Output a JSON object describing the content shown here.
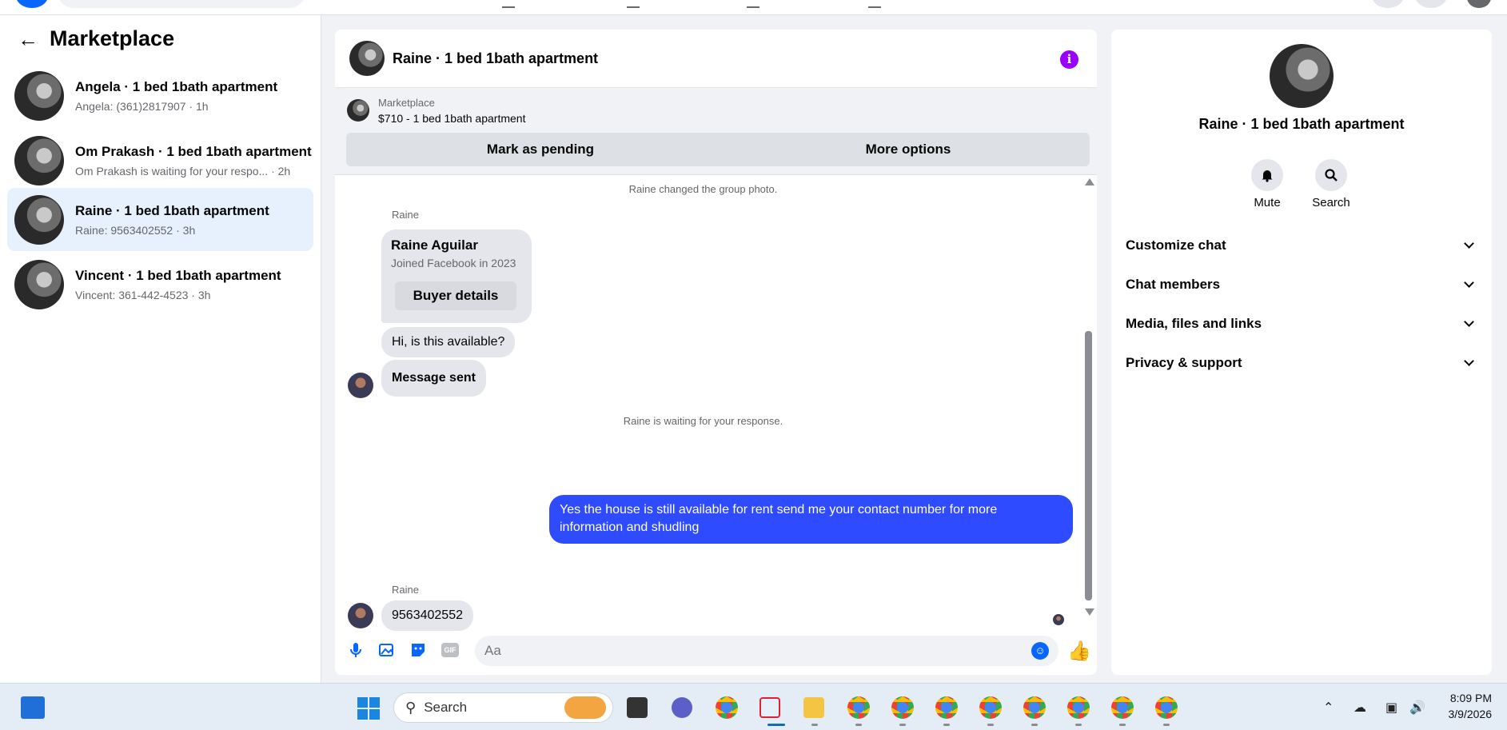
{
  "sidebar": {
    "title": "Marketplace",
    "conversations": [
      {
        "name": "Angela · 1 bed 1bath apartment",
        "preview": "Angela: (361)2817907 · 1h"
      },
      {
        "name": "Om Prakash · 1 bed 1bath apartment",
        "preview": "Om Prakash is waiting for your respo... · 2h"
      },
      {
        "name": "Raine · 1 bed 1bath apartment",
        "preview": "Raine: 9563402552 · 3h"
      },
      {
        "name": "Vincent · 1 bed 1bath apartment",
        "preview": "Vincent: 361-442-4523 · 3h"
      }
    ]
  },
  "chat": {
    "title": "Raine · 1 bed 1bath apartment",
    "listing": {
      "label": "Marketplace",
      "title": "$710 - 1 bed 1bath apartment",
      "mark_pending": "Mark as pending",
      "more_options": "More options"
    },
    "messages": {
      "group_photo": "Raine changed the group photo.",
      "sender1": "Raine",
      "card_name": "Raine Aguilar",
      "card_sub": "Joined Facebook in 2023",
      "card_button": "Buyer details",
      "msg1": "Hi, is this available?",
      "msg2": "Message sent",
      "waiting": "Raine is waiting for your response.",
      "my_reply": "Yes the house is still available for rent send me your contact number for more information and shudling",
      "sender2": "Raine",
      "msg3": "9563402552"
    },
    "composer": {
      "placeholder": "Aa",
      "gif": "GIF"
    }
  },
  "details": {
    "title": "Raine · 1 bed 1bath apartment",
    "mute": "Mute",
    "search": "Search",
    "sections": [
      "Customize chat",
      "Chat members",
      "Media, files and links",
      "Privacy & support"
    ]
  },
  "taskbar": {
    "search": "Search",
    "time": "8:09 PM",
    "date": "3/9/2026"
  },
  "colors": {
    "accent": "#0866ff",
    "my_bubble": "#2f4bff",
    "active_row": "#e7f0fd",
    "info": "#9a00ff"
  }
}
